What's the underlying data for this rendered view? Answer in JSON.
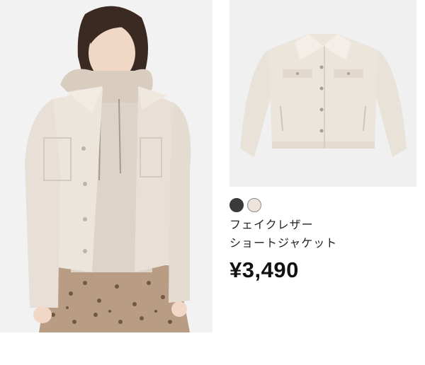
{
  "product": {
    "name_line1": "フェイクレザー",
    "name_line2": "ショートジャケット",
    "price": "¥3,490",
    "swatches": [
      {
        "name": "black",
        "color": "#3a3a3a",
        "selected": false
      },
      {
        "name": "off-white",
        "color": "#ece4da",
        "selected": true
      }
    ]
  },
  "colors": {
    "jacket": "#ece5dc",
    "hoodie": "#ddd3c6",
    "skirt": "#b89d84",
    "background": "#f1f1f1"
  }
}
